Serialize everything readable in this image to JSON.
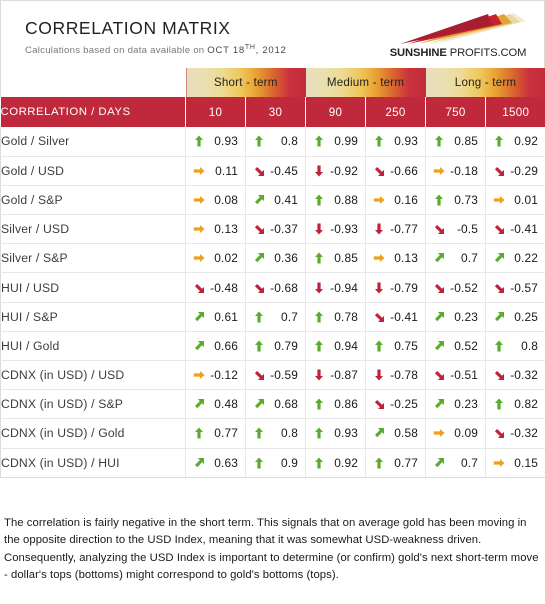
{
  "header": {
    "title": "CORRELATION MATRIX",
    "subtitle_prefix": "Calculations based on data available on",
    "date_main": "OCT 18",
    "date_sup": "TH",
    "date_year": ", 2012",
    "logo": {
      "bold_part": "SUNSHINE",
      "normal_part": " PROFITS.COM",
      "ray_colors": [
        "#a71e2e",
        "#c8202f",
        "#e0a33a",
        "#ead79a",
        "#f2ead0"
      ]
    }
  },
  "terms": [
    {
      "label": "Short - term",
      "span": 2
    },
    {
      "label": "Medium - term",
      "span": 2
    },
    {
      "label": "Long - term",
      "span": 2
    }
  ],
  "columns": {
    "label_header": "CORRELATION / DAYS",
    "days": [
      "10",
      "30",
      "90",
      "250",
      "750",
      "1500"
    ]
  },
  "colors": {
    "header_red": "#c0293c",
    "arrow_green": "#5aad2a",
    "arrow_orange": "#eda01f",
    "arrow_red": "#c1213a",
    "grid": "#e8e8e8",
    "border": "#dcdcdc"
  },
  "rows": [
    {
      "label": "Gold / Silver",
      "cells": [
        {
          "value": "0.93",
          "arrow": "up-arrow-icon",
          "color": "green"
        },
        {
          "value": "0.8",
          "arrow": "up-arrow-icon",
          "color": "green"
        },
        {
          "value": "0.99",
          "arrow": "up-arrow-icon",
          "color": "green"
        },
        {
          "value": "0.93",
          "arrow": "up-arrow-icon",
          "color": "green"
        },
        {
          "value": "0.85",
          "arrow": "up-arrow-icon",
          "color": "green"
        },
        {
          "value": "0.92",
          "arrow": "up-arrow-icon",
          "color": "green"
        }
      ]
    },
    {
      "label": "Gold / USD",
      "cells": [
        {
          "value": "0.11",
          "arrow": "right-arrow-icon",
          "color": "orange"
        },
        {
          "value": "-0.45",
          "arrow": "down-right-arrow-icon",
          "color": "red"
        },
        {
          "value": "-0.92",
          "arrow": "down-arrow-icon",
          "color": "red"
        },
        {
          "value": "-0.66",
          "arrow": "down-right-arrow-icon",
          "color": "red"
        },
        {
          "value": "-0.18",
          "arrow": "right-arrow-icon",
          "color": "orange"
        },
        {
          "value": "-0.29",
          "arrow": "down-right-arrow-icon",
          "color": "red"
        }
      ]
    },
    {
      "label": "Gold / S&P",
      "cells": [
        {
          "value": "0.08",
          "arrow": "right-arrow-icon",
          "color": "orange"
        },
        {
          "value": "0.41",
          "arrow": "up-right-arrow-icon",
          "color": "green"
        },
        {
          "value": "0.88",
          "arrow": "up-arrow-icon",
          "color": "green"
        },
        {
          "value": "0.16",
          "arrow": "right-arrow-icon",
          "color": "orange"
        },
        {
          "value": "0.73",
          "arrow": "up-arrow-icon",
          "color": "green"
        },
        {
          "value": "0.01",
          "arrow": "right-arrow-icon",
          "color": "orange"
        }
      ]
    },
    {
      "label": "Silver / USD",
      "cells": [
        {
          "value": "0.13",
          "arrow": "right-arrow-icon",
          "color": "orange"
        },
        {
          "value": "-0.37",
          "arrow": "down-right-arrow-icon",
          "color": "red"
        },
        {
          "value": "-0.93",
          "arrow": "down-arrow-icon",
          "color": "red"
        },
        {
          "value": "-0.77",
          "arrow": "down-arrow-icon",
          "color": "red"
        },
        {
          "value": "-0.5",
          "arrow": "down-right-arrow-icon",
          "color": "red"
        },
        {
          "value": "-0.41",
          "arrow": "down-right-arrow-icon",
          "color": "red"
        }
      ]
    },
    {
      "label": "Silver / S&P",
      "cells": [
        {
          "value": "0.02",
          "arrow": "right-arrow-icon",
          "color": "orange"
        },
        {
          "value": "0.36",
          "arrow": "up-right-arrow-icon",
          "color": "green"
        },
        {
          "value": "0.85",
          "arrow": "up-arrow-icon",
          "color": "green"
        },
        {
          "value": "0.13",
          "arrow": "right-arrow-icon",
          "color": "orange"
        },
        {
          "value": "0.7",
          "arrow": "up-right-arrow-icon",
          "color": "green"
        },
        {
          "value": "0.22",
          "arrow": "up-right-arrow-icon",
          "color": "green"
        }
      ]
    },
    {
      "label": "HUI / USD",
      "cells": [
        {
          "value": "-0.48",
          "arrow": "down-right-arrow-icon",
          "color": "red"
        },
        {
          "value": "-0.68",
          "arrow": "down-right-arrow-icon",
          "color": "red"
        },
        {
          "value": "-0.94",
          "arrow": "down-arrow-icon",
          "color": "red"
        },
        {
          "value": "-0.79",
          "arrow": "down-arrow-icon",
          "color": "red"
        },
        {
          "value": "-0.52",
          "arrow": "down-right-arrow-icon",
          "color": "red"
        },
        {
          "value": "-0.57",
          "arrow": "down-right-arrow-icon",
          "color": "red"
        }
      ]
    },
    {
      "label": "HUI / S&P",
      "cells": [
        {
          "value": "0.61",
          "arrow": "up-right-arrow-icon",
          "color": "green"
        },
        {
          "value": "0.7",
          "arrow": "up-arrow-icon",
          "color": "green"
        },
        {
          "value": "0.78",
          "arrow": "up-arrow-icon",
          "color": "green"
        },
        {
          "value": "-0.41",
          "arrow": "down-right-arrow-icon",
          "color": "red"
        },
        {
          "value": "0.23",
          "arrow": "up-right-arrow-icon",
          "color": "green"
        },
        {
          "value": "0.25",
          "arrow": "up-right-arrow-icon",
          "color": "green"
        }
      ]
    },
    {
      "label": "HUI / Gold",
      "cells": [
        {
          "value": "0.66",
          "arrow": "up-right-arrow-icon",
          "color": "green"
        },
        {
          "value": "0.79",
          "arrow": "up-arrow-icon",
          "color": "green"
        },
        {
          "value": "0.94",
          "arrow": "up-arrow-icon",
          "color": "green"
        },
        {
          "value": "0.75",
          "arrow": "up-arrow-icon",
          "color": "green"
        },
        {
          "value": "0.52",
          "arrow": "up-right-arrow-icon",
          "color": "green"
        },
        {
          "value": "0.8",
          "arrow": "up-arrow-icon",
          "color": "green"
        }
      ]
    },
    {
      "label": "CDNX (in USD) / USD",
      "cells": [
        {
          "value": "-0.12",
          "arrow": "right-arrow-icon",
          "color": "orange"
        },
        {
          "value": "-0.59",
          "arrow": "down-right-arrow-icon",
          "color": "red"
        },
        {
          "value": "-0.87",
          "arrow": "down-arrow-icon",
          "color": "red"
        },
        {
          "value": "-0.78",
          "arrow": "down-arrow-icon",
          "color": "red"
        },
        {
          "value": "-0.51",
          "arrow": "down-right-arrow-icon",
          "color": "red"
        },
        {
          "value": "-0.32",
          "arrow": "down-right-arrow-icon",
          "color": "red"
        }
      ]
    },
    {
      "label": "CDNX (in USD) / S&P",
      "cells": [
        {
          "value": "0.48",
          "arrow": "up-right-arrow-icon",
          "color": "green"
        },
        {
          "value": "0.68",
          "arrow": "up-right-arrow-icon",
          "color": "green"
        },
        {
          "value": "0.86",
          "arrow": "up-arrow-icon",
          "color": "green"
        },
        {
          "value": "-0.25",
          "arrow": "down-right-arrow-icon",
          "color": "red"
        },
        {
          "value": "0.23",
          "arrow": "up-right-arrow-icon",
          "color": "green"
        },
        {
          "value": "0.82",
          "arrow": "up-arrow-icon",
          "color": "green"
        }
      ]
    },
    {
      "label": "CDNX (in USD) / Gold",
      "cells": [
        {
          "value": "0.77",
          "arrow": "up-arrow-icon",
          "color": "green"
        },
        {
          "value": "0.8",
          "arrow": "up-arrow-icon",
          "color": "green"
        },
        {
          "value": "0.93",
          "arrow": "up-arrow-icon",
          "color": "green"
        },
        {
          "value": "0.58",
          "arrow": "up-right-arrow-icon",
          "color": "green"
        },
        {
          "value": "0.09",
          "arrow": "right-arrow-icon",
          "color": "orange"
        },
        {
          "value": "-0.32",
          "arrow": "down-right-arrow-icon",
          "color": "red"
        }
      ]
    },
    {
      "label": "CDNX (in USD) / HUI",
      "cells": [
        {
          "value": "0.63",
          "arrow": "up-right-arrow-icon",
          "color": "green"
        },
        {
          "value": "0.9",
          "arrow": "up-arrow-icon",
          "color": "green"
        },
        {
          "value": "0.92",
          "arrow": "up-arrow-icon",
          "color": "green"
        },
        {
          "value": "0.77",
          "arrow": "up-arrow-icon",
          "color": "green"
        },
        {
          "value": "0.7",
          "arrow": "up-right-arrow-icon",
          "color": "green"
        },
        {
          "value": "0.15",
          "arrow": "right-arrow-icon",
          "color": "orange"
        }
      ]
    }
  ],
  "footnote": {
    "text": "The correlation is fairly negative in the short term. This signals that on average gold has been moving in the opposite direction to the USD Index, meaning that it was somewhat USD-weakness driven. Consequently, analyzing the USD Index is important to determine (or confirm) gold's next short-term move - dollar's tops (bottoms) might correspond to gold's bottoms (tops)."
  }
}
